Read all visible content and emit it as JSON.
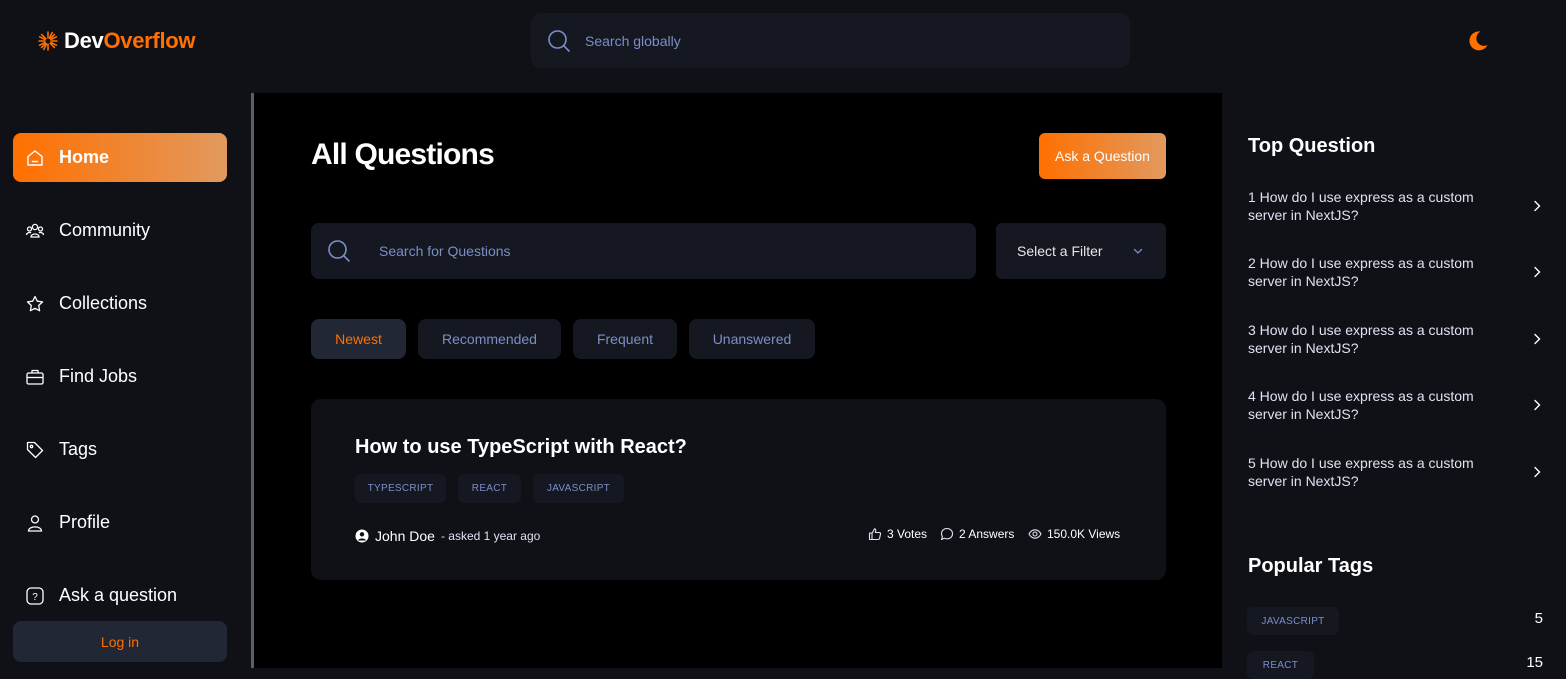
{
  "header": {
    "logo": {
      "part1": "Dev",
      "part2": "Overflow"
    },
    "search": {
      "placeholder": "Search globally"
    }
  },
  "sidebar": {
    "items": [
      {
        "label": "Home",
        "icon": "home-icon",
        "active": true
      },
      {
        "label": "Community",
        "icon": "users-icon"
      },
      {
        "label": "Collections",
        "icon": "star-icon"
      },
      {
        "label": "Find Jobs",
        "icon": "briefcase-icon"
      },
      {
        "label": "Tags",
        "icon": "tag-icon"
      },
      {
        "label": "Profile",
        "icon": "user-icon"
      },
      {
        "label": "Ask a question",
        "icon": "question-icon"
      }
    ],
    "login_label": "Log in"
  },
  "main": {
    "title": "All Questions",
    "ask_button": "Ask a Question",
    "search_placeholder": "Search for Questions",
    "filter_label": "Select a Filter",
    "tabs": [
      {
        "label": "Newest",
        "active": true
      },
      {
        "label": "Recommended"
      },
      {
        "label": "Frequent"
      },
      {
        "label": "Unanswered"
      }
    ],
    "questions": [
      {
        "title": "How to use TypeScript with React?",
        "tags": [
          "TYPESCRIPT",
          "REACT",
          "JAVASCRIPT"
        ],
        "author": "John Doe",
        "asked": "- asked 1 year ago",
        "votes": "3 Votes",
        "answers": "2 Answers",
        "views": "150.0K Views"
      }
    ]
  },
  "right_sidebar": {
    "top_title": "Top Question",
    "top_questions": [
      "1 How do I use express as a custom server in NextJS?",
      "2 How do I use express as a custom server in NextJS?",
      "3 How do I use express as a custom server in NextJS?",
      "4 How do I use express as a custom server in NextJS?",
      "5 How do I use express as a custom server in NextJS?"
    ],
    "tags_title": "Popular Tags",
    "popular_tags": [
      {
        "name": "JAVASCRIPT",
        "count": "5"
      },
      {
        "name": "REACT",
        "count": "15"
      }
    ]
  },
  "colors": {
    "accent": "#ff7000",
    "accent_gradient_end": "#e2995f",
    "bg_dark": "#0f1117",
    "bg_main": "#000000",
    "surface": "#151821",
    "muted_text": "#7b8ec8"
  }
}
